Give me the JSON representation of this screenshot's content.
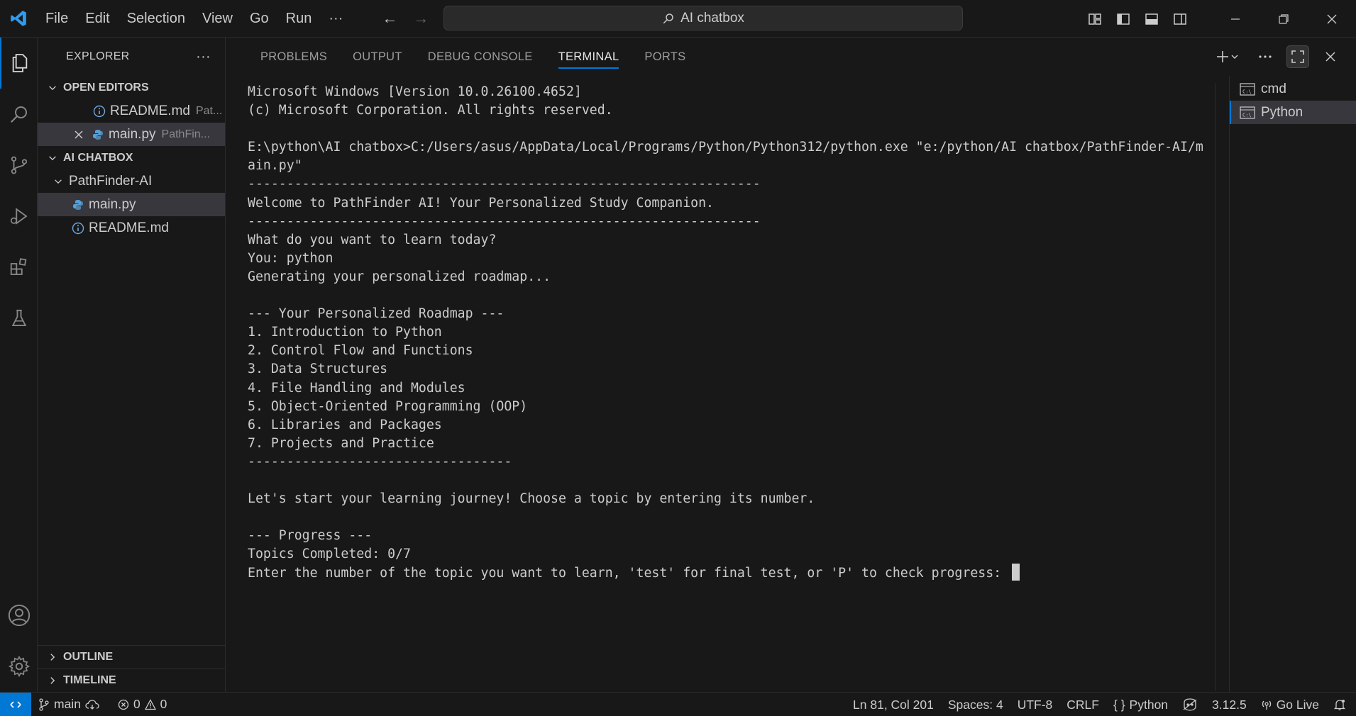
{
  "menu": [
    "File",
    "Edit",
    "Selection",
    "View",
    "Go",
    "Run",
    "···"
  ],
  "search": {
    "label": "AI chatbox"
  },
  "sidebar": {
    "title": "EXPLORER",
    "more": "···",
    "open_editors": {
      "title": "OPEN EDITORS",
      "items": [
        {
          "name": "README.md",
          "desc": "Pat..."
        },
        {
          "name": "main.py",
          "desc": "PathFin..."
        }
      ]
    },
    "workspace": {
      "title": "AI CHATBOX",
      "folder": "PathFinder-AI",
      "files": [
        "main.py",
        "README.md"
      ]
    },
    "outline": "OUTLINE",
    "timeline": "TIMELINE"
  },
  "panel": {
    "tabs": [
      "PROBLEMS",
      "OUTPUT",
      "DEBUG CONSOLE",
      "TERMINAL",
      "PORTS"
    ],
    "active_tab": "TERMINAL",
    "terminal_lines": [
      "Microsoft Windows [Version 10.0.26100.4652]",
      "(c) Microsoft Corporation. All rights reserved.",
      "",
      "E:\\python\\AI chatbox>C:/Users/asus/AppData/Local/Programs/Python/Python312/python.exe \"e:/python/AI chatbox/PathFinder-AI/m",
      "ain.py\"",
      "------------------------------------------------------------------",
      "Welcome to PathFinder AI! Your Personalized Study Companion.",
      "------------------------------------------------------------------",
      "What do you want to learn today?",
      "You: python",
      "Generating your personalized roadmap...",
      "",
      "--- Your Personalized Roadmap ---",
      "1. Introduction to Python",
      "2. Control Flow and Functions",
      "3. Data Structures",
      "4. File Handling and Modules",
      "5. Object-Oriented Programming (OOP)",
      "6. Libraries and Packages",
      "7. Projects and Practice",
      "----------------------------------",
      "",
      "Let's start your learning journey! Choose a topic by entering its number.",
      "",
      "--- Progress ---",
      "Topics Completed: 0/7"
    ],
    "prompt_line": "Enter the number of the topic you want to learn, 'test' for final test, or 'P' to check progress: ",
    "terminals": [
      "cmd",
      "Python"
    ]
  },
  "status": {
    "branch": "main",
    "errors": "0",
    "warnings": "0",
    "position": "Ln 81, Col 201",
    "spaces": "Spaces: 4",
    "encoding": "UTF-8",
    "eol": "CRLF",
    "language": "Python",
    "version": "3.12.5",
    "golive": "Go Live"
  },
  "colors": {
    "accent": "#0078d4",
    "background": "#1f1f1f"
  }
}
